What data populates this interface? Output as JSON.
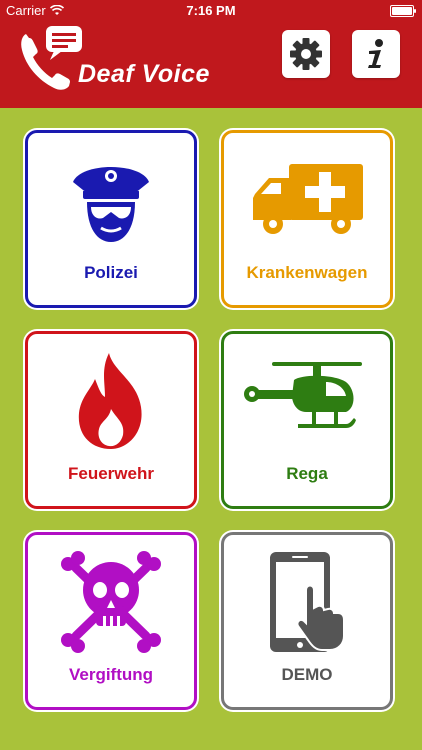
{
  "status_bar": {
    "carrier": "Carrier",
    "time": "7:16 PM"
  },
  "header": {
    "app_title": "Deaf Voice",
    "settings_icon": "gear-icon",
    "info_icon": "info-icon"
  },
  "tiles": [
    {
      "label": "Polizei",
      "icon": "police-officer-icon",
      "color": "#1a1ab0"
    },
    {
      "label": "Krankenwagen",
      "icon": "ambulance-icon",
      "color": "#e69a00"
    },
    {
      "label": "Feuerwehr",
      "icon": "fire-icon",
      "color": "#d0141b"
    },
    {
      "label": "Rega",
      "icon": "helicopter-icon",
      "color": "#2e7d12"
    },
    {
      "label": "Vergiftung",
      "icon": "skull-crossbones-icon",
      "color": "#b10fc4"
    },
    {
      "label": "DEMO",
      "icon": "smartphone-touch-icon",
      "color": "#555555"
    }
  ],
  "colors": {
    "header": "#c0181d",
    "background": "#a9c23a"
  }
}
